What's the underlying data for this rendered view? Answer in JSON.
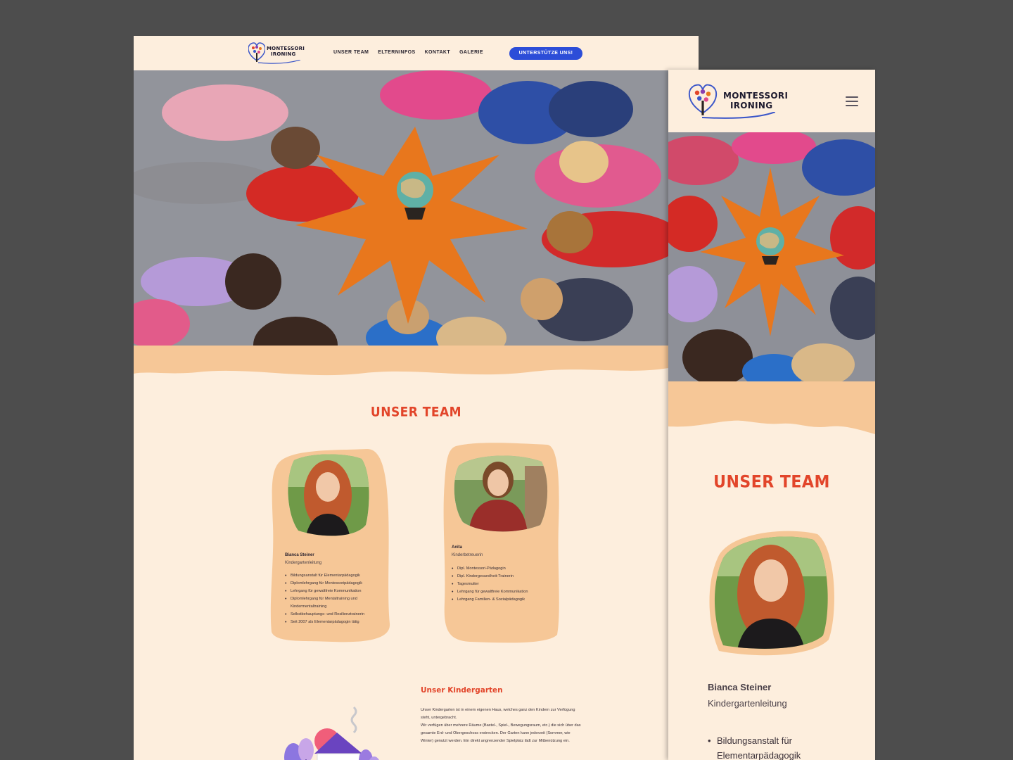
{
  "brand": {
    "logo_line1": "MONTESSORI",
    "logo_line2": "IRONING"
  },
  "nav": {
    "items": [
      "UNSER TEAM",
      "ELTERNINFOS",
      "KONTAKT",
      "GALERIE"
    ],
    "cta": "UNTERSTÜTZE UNS!"
  },
  "team": {
    "title": "UNSER TEAM",
    "members": [
      {
        "name": "Bianca Steiner",
        "role": "Kindergartenleitung",
        "qualifications": [
          "Bildungsanstalt für Elementarpädagogik",
          "Diplomlehrgang für Montessoripädagogik",
          "Lehrgang für gewaltfreie Kommunikation",
          "Diplomlehrgang für Mentaltraining und Kindermentaltraining",
          "Selbstbehauptungs- und Resilienztrainerin",
          "Seit 2007 als Elementarpädagogin tätig"
        ]
      },
      {
        "name": "Anita",
        "role": "Kinderbetreuerin",
        "qualifications": [
          "Dipl. Montessori-Pädagogin",
          "Dipl. Kindergesundheit-Trainerin",
          "Tagesmutter",
          "Lehrgang für gewaltfreie Kommunikation",
          "Lehrgang Familien- & Sozialpädagogik"
        ]
      }
    ]
  },
  "kindergarten": {
    "title": "Unser Kindergarten",
    "line1": "Unser Kindergarten ist in einem eigenen Haus, welches ganz den Kindern zur Verfügung steht, untergebracht.",
    "line2": "Wir verfügen über mehrere Räume (Bastel-, Spiel-, Bewegungsraum, etc.) die sich über das gesamte Erd- und Obergeschoss erstrecken. Der Garten kann jederzeit (Sommer, wie Winter) genutzt werden. Ein direkt angrenzender Spielplatz lädt zur Mitbenützung ein."
  },
  "mobile": {
    "title": "UNSER TEAM",
    "name": "Bianca Steiner",
    "role": "Kindergartenleitung",
    "list": [
      "Bildungsanstalt für",
      "Elementarpädagogik"
    ]
  },
  "colors": {
    "page_bg": "#fdeedd",
    "accent_orange": "#f6c797",
    "title_red": "#e2452a",
    "cta_blue": "#2c4dd8",
    "frame_bg": "#4d4d4d"
  },
  "icons": [
    "tree-logo-icon",
    "hamburger-menu-icon",
    "house-illustration"
  ]
}
